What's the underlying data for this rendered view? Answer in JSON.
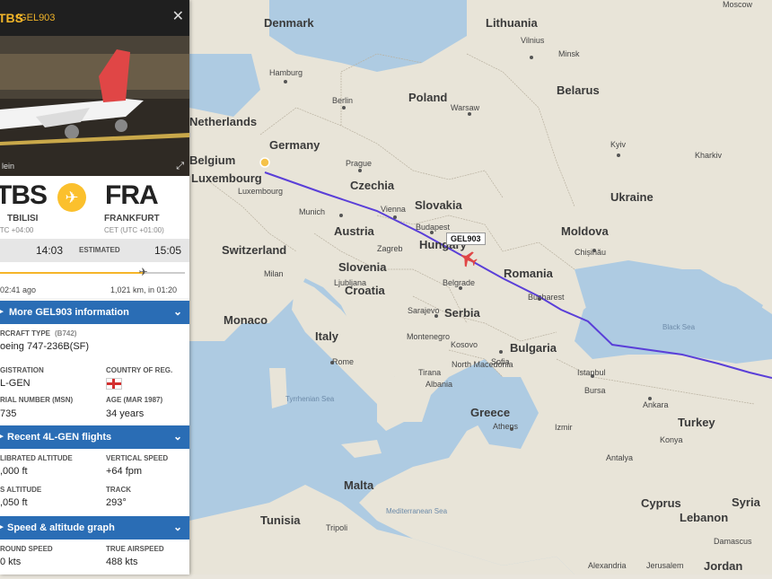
{
  "panel": {
    "callsign": "TBS",
    "flight_code": "/GEL903",
    "photo_credit": "lein",
    "origin": {
      "code": "TBS",
      "name": "TBILISI",
      "tz": "UTC +04:00"
    },
    "destination": {
      "code": "FRA",
      "name": "FRANKFURT",
      "tz": "CET (UTC +01:00)"
    },
    "times": {
      "departure": "14:03",
      "estimated_label": "ESTIMATED",
      "arrival": "15:05"
    },
    "progress": {
      "elapsed": "02:41 ago",
      "remaining": "1,021 km, in 01:20",
      "fraction": 0.78
    },
    "sections": {
      "more_info": "More GEL903 information",
      "recent_flights": "Recent 4L-GEN flights",
      "graph": "Speed & altitude graph"
    },
    "aircraft_type_label": "RCRAFT TYPE",
    "aircraft_type_code": "(B742)",
    "aircraft_type": "oeing 747-236B(SF)",
    "registration_label": "GISTRATION",
    "registration": "L-GEN",
    "country_label": "COUNTRY OF REG.",
    "msn_label": "RIAL NUMBER (MSN)",
    "msn": "735",
    "age_label": "AGE (MAR 1987)",
    "age": "34 years",
    "calibrated_alt_label": "LIBRATED ALTITUDE",
    "calibrated_alt": ",000 ft",
    "vertical_speed_label": "VERTICAL SPEED",
    "vertical_speed": "+64 fpm",
    "gps_alt_label": "S ALTITUDE",
    "gps_alt": ",050 ft",
    "track_label": "TRACK",
    "track": "293°",
    "ground_speed_label": "ROUND SPEED",
    "ground_speed": "0 kts",
    "true_airspeed_label": "TRUE AIRSPEED",
    "true_airspeed": "488 kts"
  },
  "map": {
    "flight_label": "GEL903",
    "countries": [
      "Denmark",
      "Lithuania",
      "Netherlands",
      "Poland",
      "Belarus",
      "Germany",
      "Belgium",
      "Luxembourg",
      "Czechia",
      "Ukraine",
      "Slovakia",
      "Austria",
      "Hungary",
      "Moldova",
      "Switzerland",
      "Slovenia",
      "Romania",
      "Croatia",
      "Monaco",
      "Serbia",
      "Italy",
      "Bulgaria",
      "Greece",
      "Turkey",
      "Malta",
      "Cyprus",
      "Syria",
      "Tunisia",
      "Lebanon",
      "Jordan"
    ],
    "cities": [
      "Moscow",
      "Vilnius",
      "Minsk",
      "Hamburg",
      "Berlin",
      "Warsaw",
      "Kyiv",
      "Kharkiv",
      "Prague",
      "Munich",
      "Vienna",
      "Budapest",
      "Chișinău",
      "Milan",
      "Belgrade",
      "Bucharest",
      "Sarajevo",
      "Montenegro",
      "Kosovo",
      "Sofia",
      "Tirana",
      "North Macedonia",
      "Albania",
      "Rome",
      "Istanbul",
      "Bursa",
      "Ankara",
      "Izmir",
      "Athens",
      "Antalya",
      "Tripoli",
      "Damascus",
      "Jerusalem",
      "Alexandria",
      "Konya",
      "Zagreb",
      "Ljubljana",
      "Luxembourg"
    ],
    "seas": [
      "Black Sea",
      "Tyrrhenian Sea",
      "Mediterranean Sea"
    ]
  }
}
